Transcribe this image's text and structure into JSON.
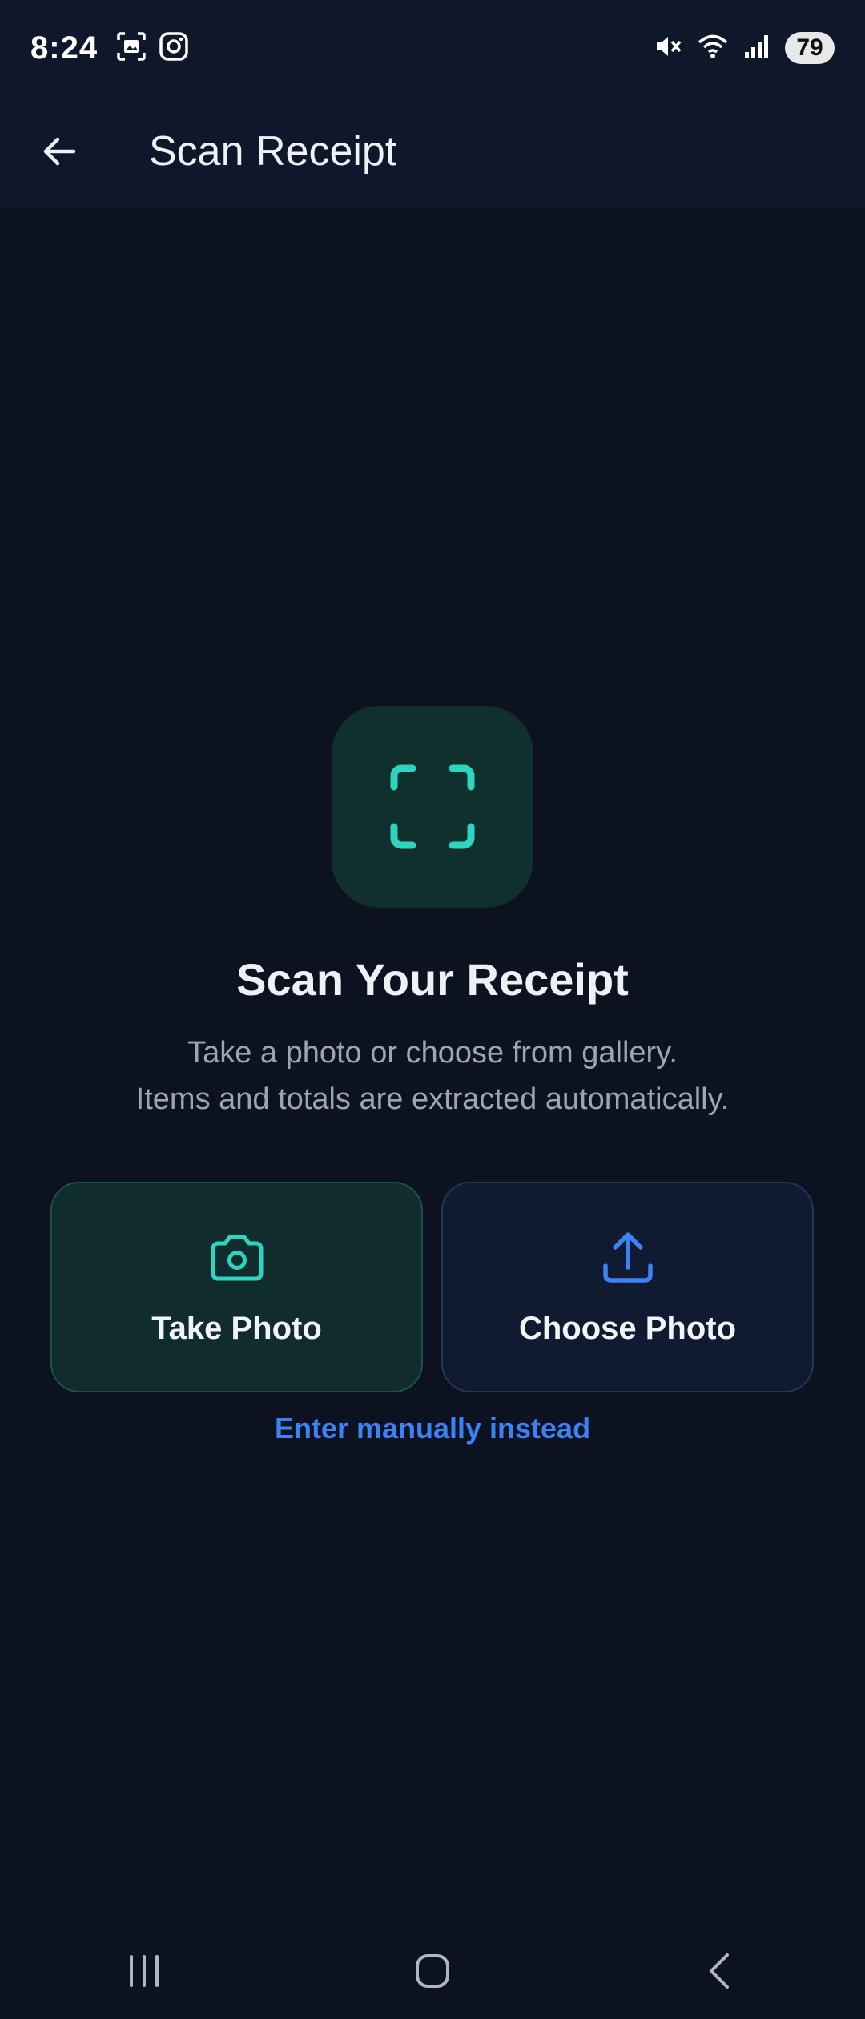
{
  "status_bar": {
    "time": "8:24",
    "battery": "79",
    "icons": [
      "screenshot-icon",
      "instagram-icon",
      "mute-icon",
      "wifi-icon",
      "signal-icon"
    ]
  },
  "app_bar": {
    "title": "Scan Receipt",
    "back_icon": "arrow-left-icon"
  },
  "hero": {
    "icon": "scan-frame-icon",
    "title": "Scan Your Receipt",
    "line1": "Take a photo or choose from gallery.",
    "line2": "Items and totals are extracted automatically."
  },
  "actions": {
    "take_photo": {
      "label": "Take Photo",
      "icon": "camera-icon"
    },
    "choose_photo": {
      "label": "Choose Photo",
      "icon": "upload-icon"
    },
    "manual_link": "Enter manually instead"
  },
  "colors": {
    "accent_teal": "#2dd4bf",
    "accent_blue": "#3b82f6",
    "background": "#0c121f",
    "bar": "#0f172a"
  }
}
